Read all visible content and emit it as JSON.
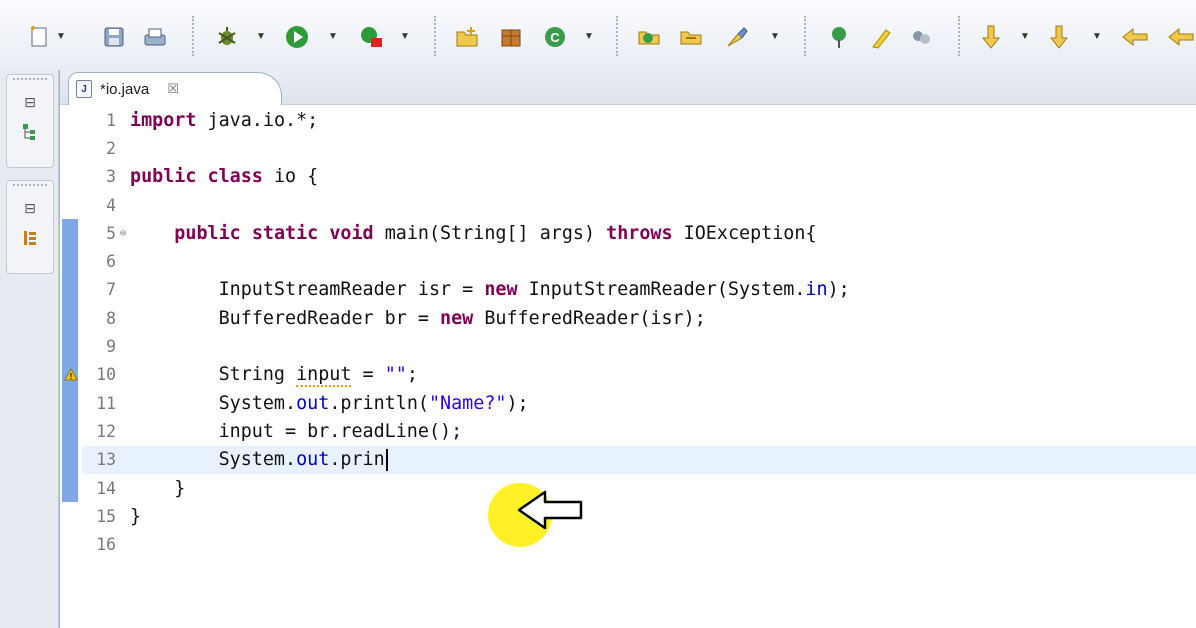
{
  "editor": {
    "tab_label": "*io.java",
    "tab_icon_letter": "J",
    "tab_close": "☒",
    "lines": [
      {
        "n": "1",
        "text": "import java.io.*;"
      },
      {
        "n": "2",
        "text": ""
      },
      {
        "n": "3",
        "text": "public class io {"
      },
      {
        "n": "4",
        "text": ""
      },
      {
        "n": "5",
        "text": "    public static void main(String[] args) throws IOException{"
      },
      {
        "n": "6",
        "text": ""
      },
      {
        "n": "7",
        "text": "        InputStreamReader isr = new InputStreamReader(System.in);"
      },
      {
        "n": "8",
        "text": "        BufferedReader br = new BufferedReader(isr);"
      },
      {
        "n": "9",
        "text": ""
      },
      {
        "n": "10",
        "text": "        String input = \"\";"
      },
      {
        "n": "11",
        "text": "        System.out.println(\"Name?\");"
      },
      {
        "n": "12",
        "text": "        input = br.readLine();"
      },
      {
        "n": "13",
        "text": "        System.out.prin"
      },
      {
        "n": "14",
        "text": "    }"
      },
      {
        "n": "15",
        "text": "}"
      },
      {
        "n": "16",
        "text": ""
      }
    ],
    "current_line": "13",
    "warning_line": "10",
    "fold_line": "5",
    "changed_lines_from": "5",
    "changed_lines_to": "14"
  },
  "toolbar_icons": [
    "new-wizard-icon",
    "save-icon",
    "print-icon",
    "debug-icon",
    "run-icon",
    "external-tools-icon",
    "new-java-project-icon",
    "new-package-icon",
    "new-class-icon",
    "open-type-icon",
    "open-task-icon",
    "annotation-icon",
    "pin-icon",
    "highlighter-icon",
    "mark-occurrences-icon",
    "next-annotation-icon",
    "previous-annotation-icon",
    "back-icon",
    "forward-icon"
  ],
  "colors": {
    "keyword": "#7f0055",
    "string": "#2a00ff",
    "field": "#0000c0",
    "current_line_bg": "#e8f2fe",
    "change_marker": "#7ea9e4",
    "cursor_highlight": "#ffee00"
  }
}
